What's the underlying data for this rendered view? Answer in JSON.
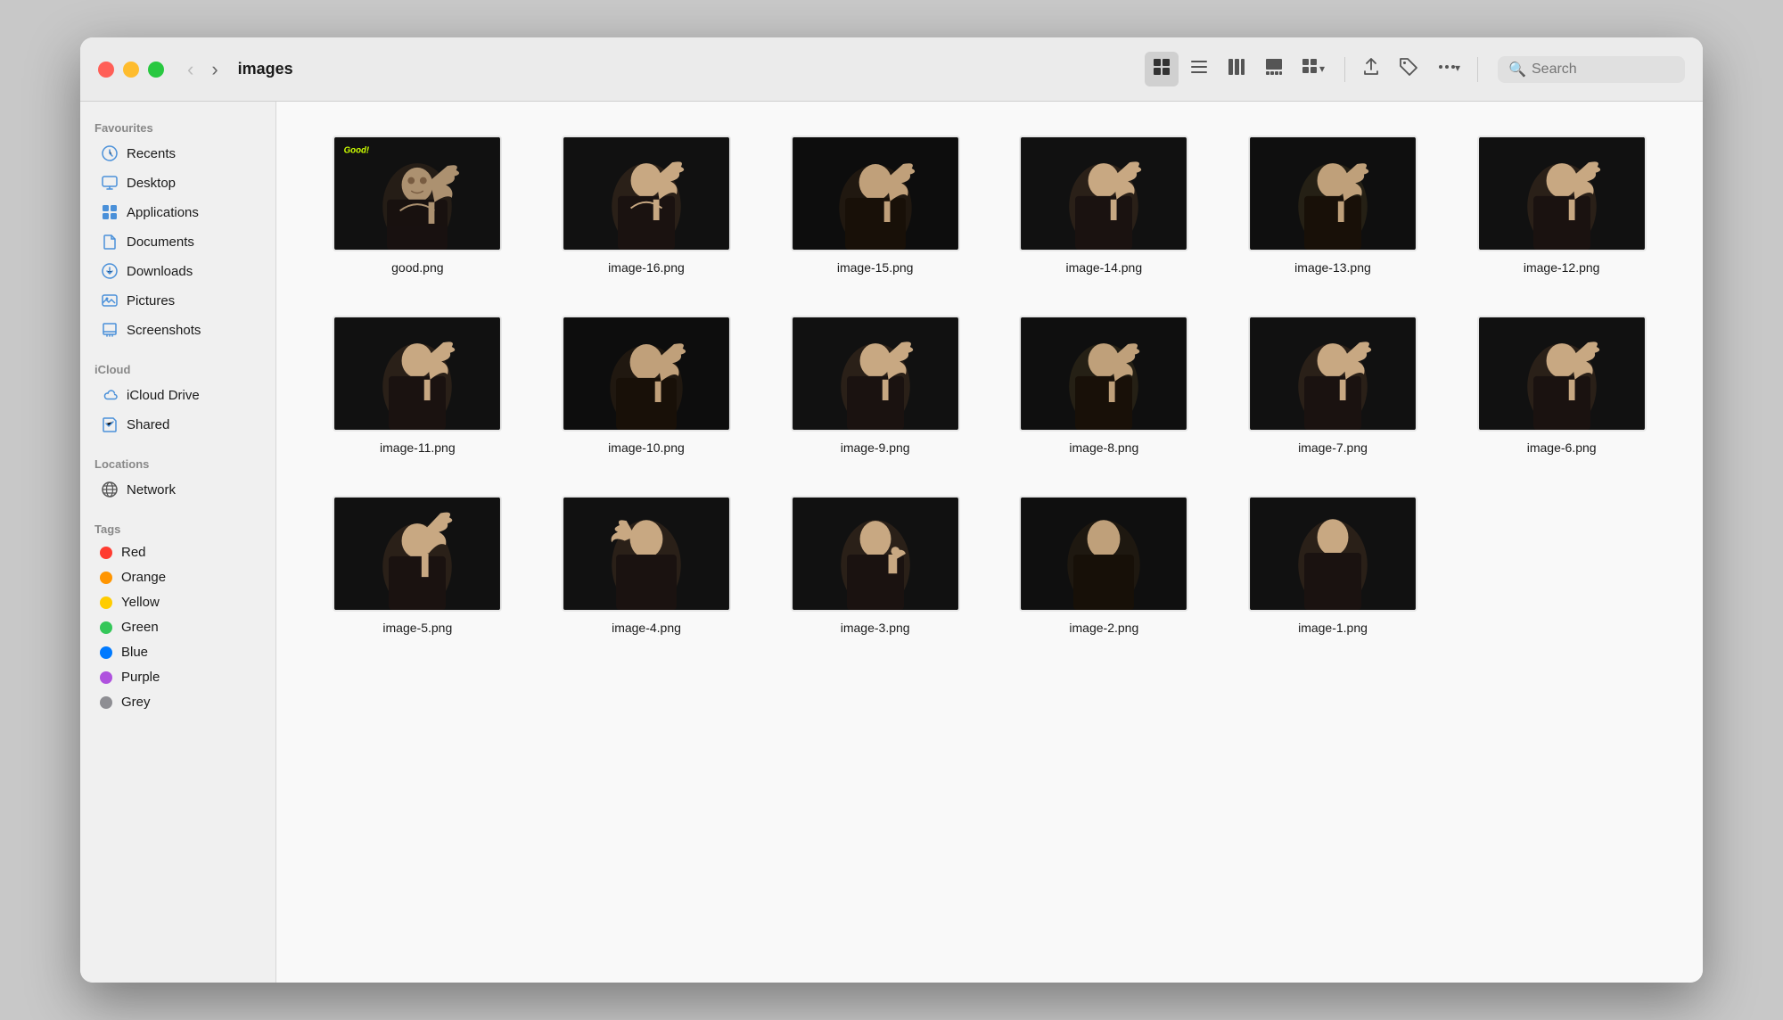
{
  "window": {
    "title": "images"
  },
  "toolbar": {
    "back_label": "‹",
    "forward_label": "›",
    "view_grid_label": "⊞",
    "view_list_label": "☰",
    "view_columns_label": "⊟",
    "view_gallery_label": "⊡",
    "view_group_label": "⊞▾",
    "share_label": "↑",
    "tag_label": "◇",
    "more_label": "⋯▾",
    "search_placeholder": "Search"
  },
  "sidebar": {
    "favourites_label": "Favourites",
    "items_favourites": [
      {
        "id": "recents",
        "label": "Recents",
        "icon": "🕐",
        "icon_color": "#4a90d9"
      },
      {
        "id": "desktop",
        "label": "Desktop",
        "icon": "🖥",
        "icon_color": "#4a90d9"
      },
      {
        "id": "applications",
        "label": "Applications",
        "icon": "✦",
        "icon_color": "#4a90d9"
      },
      {
        "id": "documents",
        "label": "Documents",
        "icon": "📄",
        "icon_color": "#4a90d9"
      },
      {
        "id": "downloads",
        "label": "Downloads",
        "icon": "↓",
        "icon_color": "#4a90d9"
      },
      {
        "id": "pictures",
        "label": "Pictures",
        "icon": "🖼",
        "icon_color": "#4a90d9"
      },
      {
        "id": "screenshots",
        "label": "Screenshots",
        "icon": "📁",
        "icon_color": "#4a90d9"
      }
    ],
    "icloud_label": "iCloud",
    "items_icloud": [
      {
        "id": "icloud-drive",
        "label": "iCloud Drive",
        "icon": "☁",
        "icon_color": "#4a90d9"
      },
      {
        "id": "shared",
        "label": "Shared",
        "icon": "📁",
        "icon_color": "#4a90d9"
      }
    ],
    "locations_label": "Locations",
    "items_locations": [
      {
        "id": "network",
        "label": "Network",
        "icon": "🌐",
        "icon_color": "#555"
      }
    ],
    "tags_label": "Tags",
    "tags": [
      {
        "id": "red",
        "label": "Red",
        "color": "#ff3b30"
      },
      {
        "id": "orange",
        "label": "Orange",
        "color": "#ff9500"
      },
      {
        "id": "yellow",
        "label": "Yellow",
        "color": "#ffcc00"
      },
      {
        "id": "green",
        "label": "Green",
        "color": "#34c759"
      },
      {
        "id": "blue",
        "label": "Blue",
        "color": "#007aff"
      },
      {
        "id": "purple",
        "label": "Purple",
        "color": "#af52de"
      },
      {
        "id": "grey",
        "label": "Grey",
        "color": "#8e8e93"
      }
    ]
  },
  "files": {
    "row1": [
      {
        "name": "good.png",
        "has_good": true
      },
      {
        "name": "image-16.png"
      },
      {
        "name": "image-15.png"
      },
      {
        "name": "image-14.png"
      },
      {
        "name": "image-13.png"
      },
      {
        "name": "image-12.png"
      }
    ],
    "row2": [
      {
        "name": "image-11.png"
      },
      {
        "name": "image-10.png"
      },
      {
        "name": "image-9.png"
      },
      {
        "name": "image-8.png"
      },
      {
        "name": "image-7.png"
      },
      {
        "name": "image-6.png"
      }
    ],
    "row3": [
      {
        "name": "image-5.png"
      },
      {
        "name": "image-4.png"
      },
      {
        "name": "image-3.png"
      },
      {
        "name": "image-2.png"
      },
      {
        "name": "image-1.png"
      }
    ]
  }
}
